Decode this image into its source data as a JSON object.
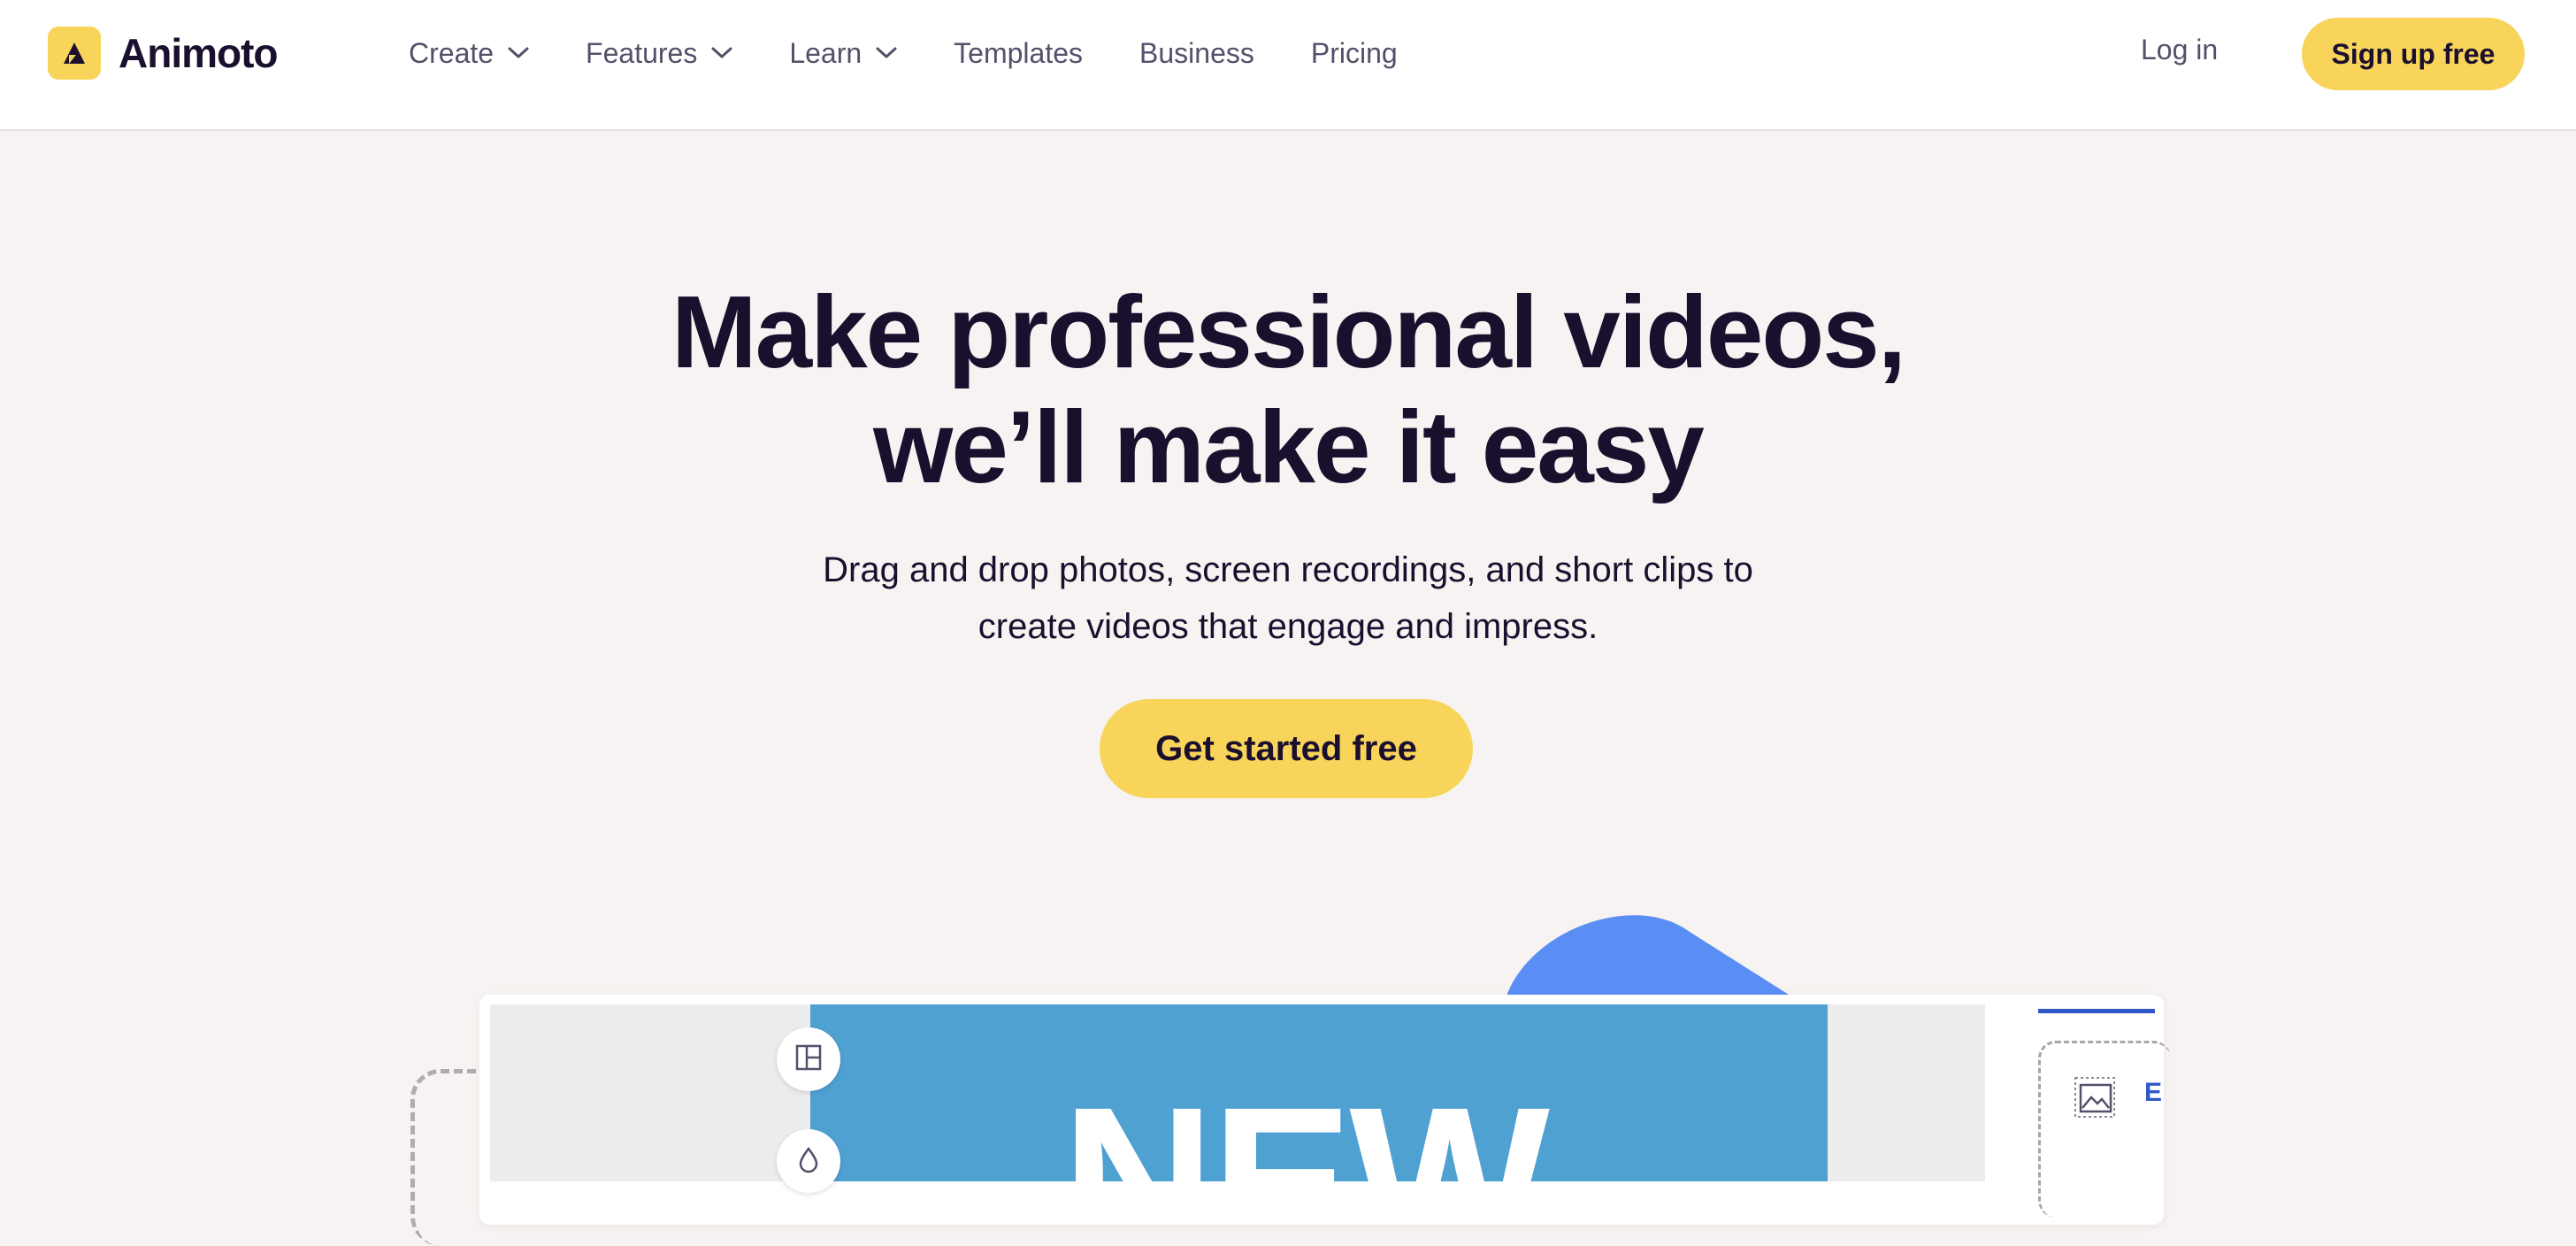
{
  "brand": {
    "name": "Animoto",
    "logo_icon": "animoto-logo-icon",
    "accent_color": "#f8d55a",
    "text_color": "#1b0f2e"
  },
  "nav": {
    "items": [
      {
        "label": "Create",
        "has_dropdown": true
      },
      {
        "label": "Features",
        "has_dropdown": true
      },
      {
        "label": "Learn",
        "has_dropdown": true
      },
      {
        "label": "Templates",
        "has_dropdown": false
      },
      {
        "label": "Business",
        "has_dropdown": false
      },
      {
        "label": "Pricing",
        "has_dropdown": false
      }
    ],
    "login_label": "Log in",
    "signup_label": "Sign up free"
  },
  "hero": {
    "title_line1": "Make professional videos,",
    "title_line2": "we’ll make it easy",
    "subtitle_line1": "Drag and drop photos, screen recordings, and short clips to",
    "subtitle_line2": "create videos that engage and impress.",
    "cta_label": "Get started free"
  },
  "editor_preview": {
    "video_text": "NEW",
    "video_bg_color": "#4fa1d2",
    "blob_color": "#5b8ef5",
    "tools": [
      "layout-icon",
      "droplet-icon"
    ],
    "panel_tab_color": "#2f59c9",
    "panel_label_partial": "E"
  }
}
